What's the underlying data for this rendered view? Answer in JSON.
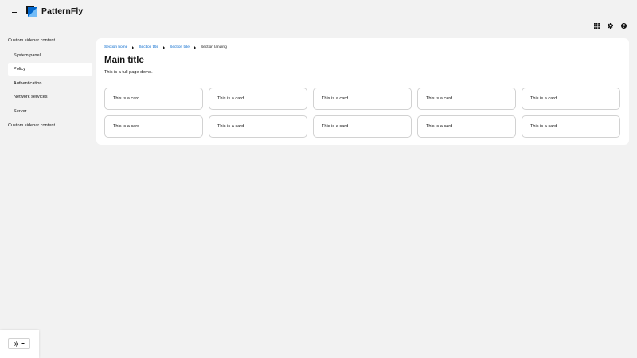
{
  "header": {
    "logo_text": "PatternFly",
    "icons": [
      "menu-icon",
      "logo-icon",
      "grid-icon",
      "gear-icon",
      "help-icon"
    ]
  },
  "sidebar": {
    "top_heading": "Custom sidebar content",
    "items": [
      {
        "label": "System panel"
      },
      {
        "label": "Policy",
        "active": true
      },
      {
        "label": "Authentication"
      },
      {
        "label": "Network services"
      },
      {
        "label": "Server"
      }
    ],
    "bottom_heading": "Custom sidebar content"
  },
  "breadcrumb": {
    "items": [
      {
        "label": "Section home"
      },
      {
        "label": "Section title"
      },
      {
        "label": "Section title"
      },
      {
        "label": "Section landing"
      }
    ]
  },
  "main": {
    "title": "Main title",
    "description": "This is a full page demo."
  },
  "cards": [
    {
      "label": "This is a card"
    },
    {
      "label": "This is a card"
    },
    {
      "label": "This is a card"
    },
    {
      "label": "This is a card"
    },
    {
      "label": "This is a card"
    },
    {
      "label": "This is a card"
    },
    {
      "label": "This is a card"
    },
    {
      "label": "This is a card"
    },
    {
      "label": "This is a card"
    },
    {
      "label": "This is a card"
    }
  ],
  "theme_selector": {
    "icon": "sun-icon"
  },
  "colors": {
    "link": "#0066cc",
    "background": "#f2f2f2",
    "panel": "#ffffff",
    "logo_blue": "#0066cc"
  }
}
